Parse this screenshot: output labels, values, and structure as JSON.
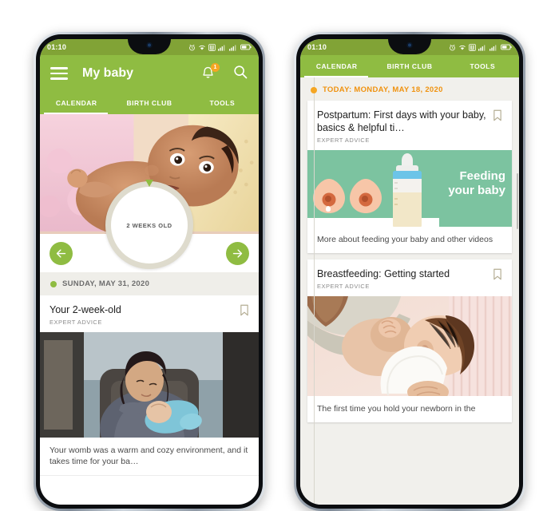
{
  "phone1": {
    "statusbar": {
      "time": "01:10",
      "icons": [
        "alarm-icon",
        "wifi-icon",
        "sim-icon",
        "signal-icon",
        "signal-icon",
        "battery-icon"
      ]
    },
    "appbar": {
      "title": "My baby",
      "menu_icon": "hamburger-icon",
      "bell_icon": "bell-icon",
      "badge_count": "1",
      "search_icon": "search-icon"
    },
    "tabs": [
      {
        "label": "CALENDAR",
        "active": true
      },
      {
        "label": "BIRTH CLUB",
        "active": false
      },
      {
        "label": "TOOLS",
        "active": false
      }
    ],
    "age_ring": {
      "label": "2 WEEKS OLD"
    },
    "nav": {
      "prev_icon": "arrow-left-icon",
      "next_icon": "arrow-right-icon"
    },
    "day": {
      "label": "SUNDAY, MAY 31, 2020"
    },
    "card": {
      "title": "Your 2-week-old",
      "kicker": "EXPERT ADVICE",
      "bookmark_icon": "bookmark-icon",
      "excerpt": "Your womb was a warm and cozy environment, and it takes time for your ba…"
    }
  },
  "phone2": {
    "statusbar": {
      "time": "01:10",
      "icons": [
        "alarm-icon",
        "wifi-icon",
        "sim-icon",
        "signal-icon",
        "signal-icon",
        "battery-icon"
      ]
    },
    "tabs": [
      {
        "label": "CALENDAR",
        "active": true
      },
      {
        "label": "BIRTH CLUB",
        "active": false
      },
      {
        "label": "TOOLS",
        "active": false
      }
    ],
    "day": {
      "label": "TODAY: MONDAY, MAY 18, 2020"
    },
    "cards": [
      {
        "title": "Postpartum: First days with your baby, basics & helpful ti…",
        "kicker": "EXPERT ADVICE",
        "bookmark_icon": "bookmark-icon",
        "banner_title_line1": "Feeding",
        "banner_title_line2": "your baby",
        "excerpt": "More about feeding your baby and other videos"
      },
      {
        "title": "Breastfeeding: Getting started",
        "kicker": "EXPERT ADVICE",
        "bookmark_icon": "bookmark-icon",
        "excerpt": "The first time you hold your newborn in the"
      }
    ]
  },
  "colors": {
    "appbar_green": "#8fbc42",
    "statusbar_green": "#81a336",
    "accent_orange": "#f5a623",
    "banner_green": "#7cc3a0",
    "ring_beige": "#dedbcd"
  }
}
